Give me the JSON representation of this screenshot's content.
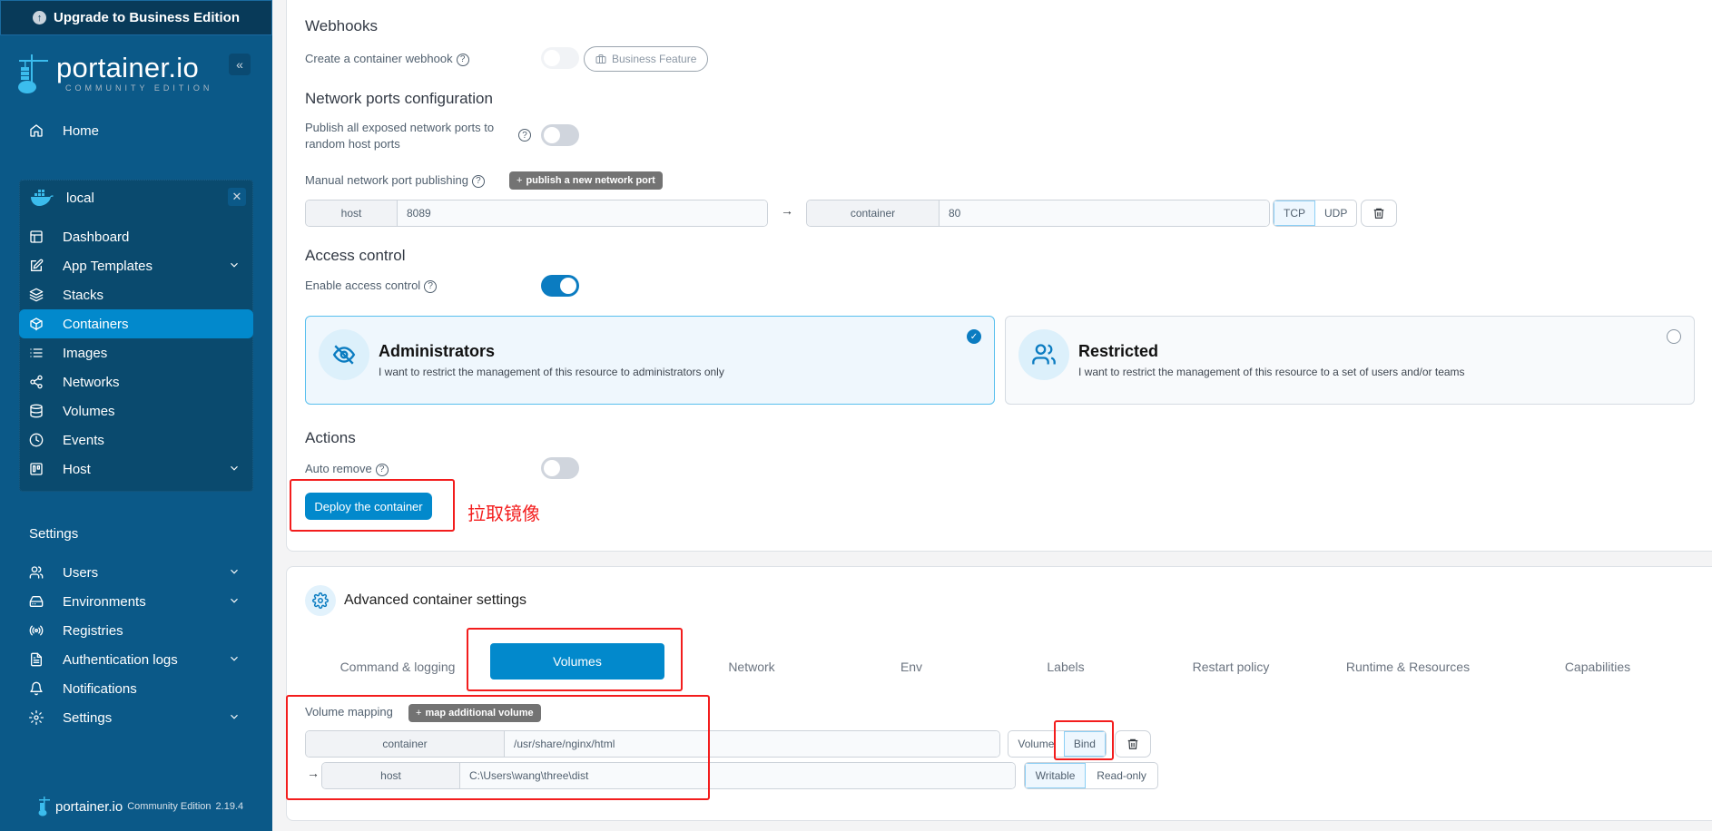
{
  "sidebar": {
    "upgrade_label": "Upgrade to Business Edition",
    "logo": {
      "name": "portainer.io",
      "edition": "COMMUNITY EDITION"
    },
    "collapse_icon": "chevrons-left-icon",
    "home_label": "Home",
    "environment": {
      "name": "local",
      "icon": "docker-icon"
    },
    "env_items": [
      {
        "label": "Dashboard",
        "icon": "layout-icon",
        "expandable": false,
        "active": false
      },
      {
        "label": "App Templates",
        "icon": "edit-icon",
        "expandable": true,
        "active": false
      },
      {
        "label": "Stacks",
        "icon": "layers-icon",
        "expandable": false,
        "active": false
      },
      {
        "label": "Containers",
        "icon": "box-icon",
        "expandable": false,
        "active": true
      },
      {
        "label": "Images",
        "icon": "list-icon",
        "expandable": false,
        "active": false
      },
      {
        "label": "Networks",
        "icon": "share-icon",
        "expandable": false,
        "active": false
      },
      {
        "label": "Volumes",
        "icon": "database-icon",
        "expandable": false,
        "active": false
      },
      {
        "label": "Events",
        "icon": "clock-icon",
        "expandable": false,
        "active": false
      },
      {
        "label": "Host",
        "icon": "trello-icon",
        "expandable": true,
        "active": false
      }
    ],
    "settings_title": "Settings",
    "settings_items": [
      {
        "label": "Users",
        "icon": "users-icon",
        "expandable": true
      },
      {
        "label": "Environments",
        "icon": "hard-drive-icon",
        "expandable": true
      },
      {
        "label": "Registries",
        "icon": "radio-icon",
        "expandable": false
      },
      {
        "label": "Authentication logs",
        "icon": "file-text-icon",
        "expandable": true
      },
      {
        "label": "Notifications",
        "icon": "bell-icon",
        "expandable": false
      },
      {
        "label": "Settings",
        "icon": "settings-icon",
        "expandable": true
      }
    ],
    "footer": {
      "brand": "portainer.io",
      "edition": "Community Edition",
      "version": "2.19.4"
    }
  },
  "webhooks": {
    "title": "Webhooks",
    "create_label": "Create a container webhook",
    "business_badge": "Business Feature",
    "enabled": false
  },
  "network_ports": {
    "title": "Network ports configuration",
    "publish_all_label": "Publish all exposed network ports to random host ports",
    "publish_all_enabled": false,
    "manual_label": "Manual network port publishing",
    "add_button": "publish a new network port",
    "mapping": {
      "host_addon": "host",
      "host_value": "8089",
      "container_addon": "container",
      "container_value": "80",
      "protocols": [
        "TCP",
        "UDP"
      ],
      "selected_protocol": "TCP"
    }
  },
  "access_control": {
    "title": "Access control",
    "enable_label": "Enable access control",
    "enabled": true,
    "options": [
      {
        "title": "Administrators",
        "description": "I want to restrict the management of this resource to administrators only",
        "selected": true,
        "icon": "eye-off-icon"
      },
      {
        "title": "Restricted",
        "description": "I want to restrict the management of this resource to a set of users and/or teams",
        "selected": false,
        "icon": "users-icon"
      }
    ]
  },
  "actions": {
    "title": "Actions",
    "auto_remove_label": "Auto remove",
    "auto_remove_enabled": false,
    "deploy_button": "Deploy the container"
  },
  "annotation": {
    "text": "拉取镜像",
    "color": "#f31d1d"
  },
  "advanced": {
    "title": "Advanced container settings",
    "tabs": [
      "Command & logging",
      "Volumes",
      "Network",
      "Env",
      "Labels",
      "Restart policy",
      "Runtime & Resources",
      "Capabilities"
    ],
    "active_tab": "Volumes",
    "volume_mapping": {
      "label": "Volume mapping",
      "add_button": "map additional volume",
      "container_addon": "container",
      "container_value": "/usr/share/nginx/html",
      "type_options": [
        "Volume",
        "Bind"
      ],
      "selected_type": "Bind",
      "host_addon": "host",
      "host_value": "C:\\Users\\wang\\three\\dist",
      "mode_options": [
        "Writable",
        "Read-only"
      ],
      "selected_mode": "Writable"
    }
  },
  "colors": {
    "sidebar_bg": "#0b5988",
    "sidebar_active": "#0289cc",
    "primary": "#0289cc",
    "annotation_red": "#f31d1d"
  }
}
